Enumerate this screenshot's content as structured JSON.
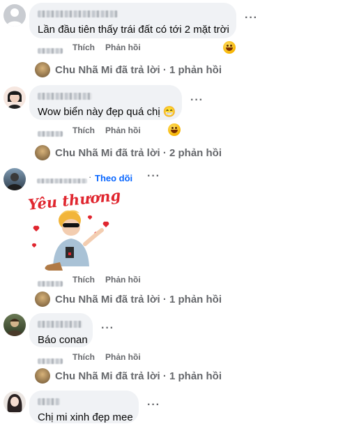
{
  "comments": [
    {
      "text": "Lần đầu tiên thấy trái đất có tới 2 mặt trời",
      "like": "Thích",
      "reply": "Phản hồi",
      "replies_summary": "Chu Nhã Mi đã trả lời · 1 phản hồi"
    },
    {
      "text": "Wow biển này đẹp quá chị 😁",
      "like": "Thích",
      "reply": "Phản hồi",
      "replies_summary": "Chu Nhã Mi đã trả lời · 2 phản hồi"
    },
    {
      "follow": "Theo dõi",
      "sticker_text": "Yêu thương",
      "like": "Thích",
      "reply": "Phản hồi",
      "replies_summary": "Chu Nhã Mi đã trả lời · 1 phản hồi"
    },
    {
      "text": "Báo conan",
      "like": "Thích",
      "reply": "Phản hồi",
      "replies_summary": "Chu Nhã Mi đã trả lời · 1 phản hồi"
    },
    {
      "text": "Chị mi xinh đẹp mee"
    }
  ],
  "more_symbol": "···",
  "colors": {
    "bubble": "#f0f2f5",
    "secondary_text": "#65676b",
    "link_blue": "#0866ff",
    "sticker_red": "#e0262f"
  }
}
